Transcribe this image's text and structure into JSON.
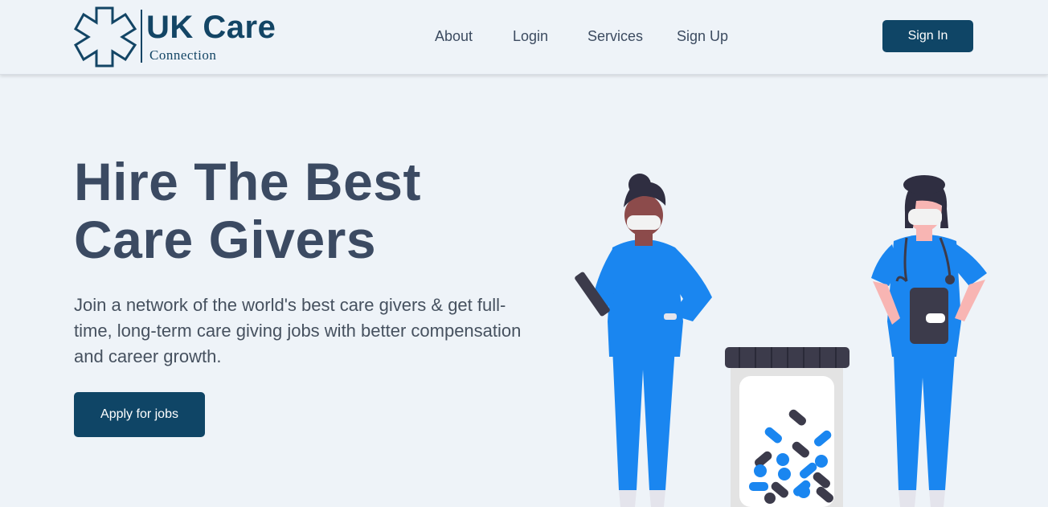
{
  "header": {
    "logo": {
      "title": "UK Care",
      "subtitle": "Connection",
      "icon": "medical-star-icon"
    },
    "nav": [
      {
        "label": "About"
      },
      {
        "label": "Login"
      },
      {
        "label": "Services"
      },
      {
        "label": "Sign Up"
      }
    ],
    "sign_in_label": "Sign In"
  },
  "hero": {
    "title_line1": "Hire The Best",
    "title_line2": "Care Givers",
    "description": "Join a network of the world's best care givers & get full-time, long-term care giving jobs with better compensation and career growth.",
    "cta_label": "Apply for jobs"
  },
  "illustration": {
    "subject": "two-nurses-with-pill-jar",
    "colors": {
      "scrub_blue": "#1a86f0",
      "dark": "#3c3b4b",
      "skin_dark": "#8c4b4b",
      "skin_light": "#f8b5b3"
    }
  },
  "colors": {
    "background": "#eef3f8",
    "primary": "#0f4566",
    "text_heading": "#3b4a62",
    "text_body": "#46515f"
  }
}
